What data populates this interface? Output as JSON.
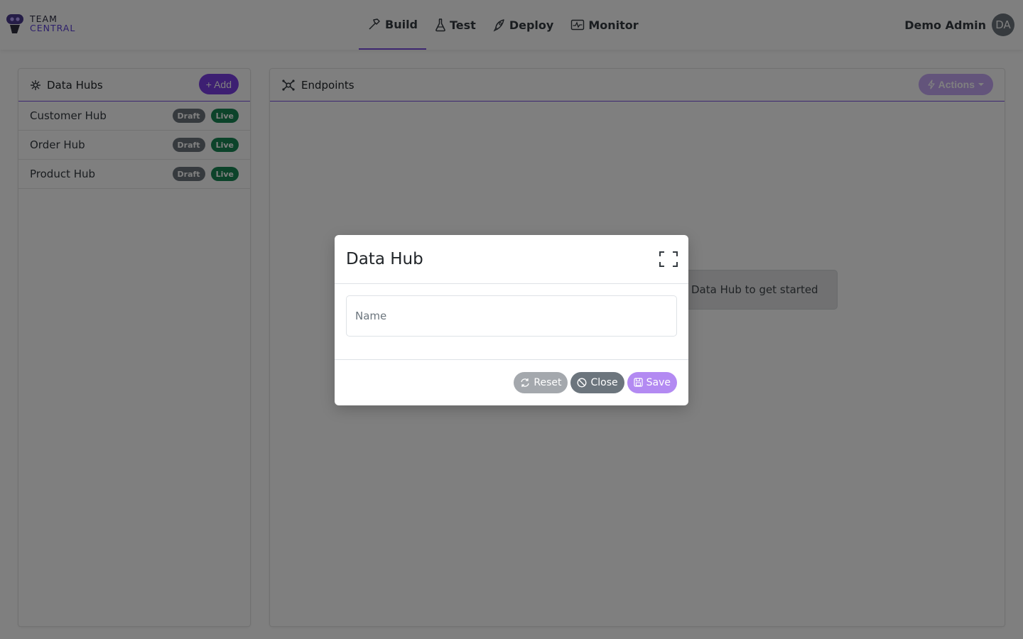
{
  "brand": {
    "line1": "TEAM",
    "line2": "CENTRAL"
  },
  "nav": {
    "tabs": [
      {
        "label": "Build",
        "icon": "hammer-icon",
        "active": true
      },
      {
        "label": "Test",
        "icon": "flask-icon",
        "active": false
      },
      {
        "label": "Deploy",
        "icon": "rocket-icon",
        "active": false
      },
      {
        "label": "Monitor",
        "icon": "activity-icon",
        "active": false
      }
    ],
    "user_name": "Demo Admin",
    "avatar_initials": "DA"
  },
  "hubs_panel": {
    "title": "Data Hubs",
    "add_label": "+ Add",
    "items": [
      {
        "name": "Customer Hub",
        "badge_draft": "Draft",
        "badge_live": "Live"
      },
      {
        "name": "Order Hub",
        "badge_draft": "Draft",
        "badge_live": "Live"
      },
      {
        "name": "Product Hub",
        "badge_draft": "Draft",
        "badge_live": "Live"
      }
    ]
  },
  "endpoints_panel": {
    "title": "Endpoints",
    "actions_label": "Actions",
    "empty_message": "Data Hub to get started"
  },
  "modal": {
    "title": "Data Hub",
    "name_placeholder": "Name",
    "name_value": "",
    "reset_label": "Reset",
    "close_label": "Close",
    "save_label": "Save"
  },
  "colors": {
    "accent": "#7b3fe4",
    "draft_badge": "#6c757d",
    "live_badge": "#198754",
    "save_button": "#b38af2"
  }
}
